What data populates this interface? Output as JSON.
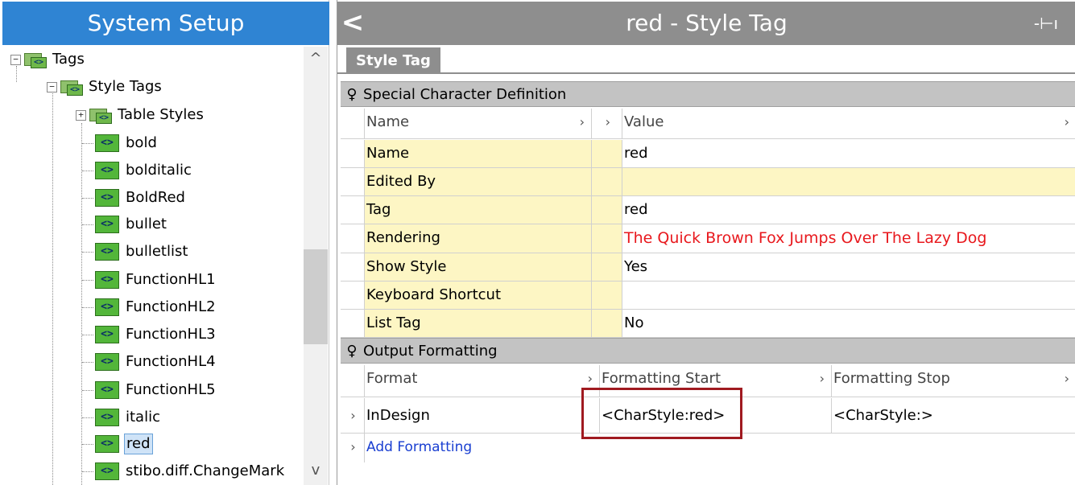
{
  "left_panel": {
    "title": "System Setup",
    "tree": [
      {
        "label": "Tags",
        "level": 0,
        "type": "folder",
        "expander": "−"
      },
      {
        "label": "Style Tags",
        "level": 1,
        "type": "folder",
        "expander": "−"
      },
      {
        "label": "Table Styles",
        "level": 2,
        "type": "folder",
        "expander": "+"
      },
      {
        "label": "bold",
        "level": 2,
        "type": "tag"
      },
      {
        "label": "bolditalic",
        "level": 2,
        "type": "tag"
      },
      {
        "label": "BoldRed",
        "level": 2,
        "type": "tag"
      },
      {
        "label": "bullet",
        "level": 2,
        "type": "tag"
      },
      {
        "label": "bulletlist",
        "level": 2,
        "type": "tag"
      },
      {
        "label": "FunctionHL1",
        "level": 2,
        "type": "tag"
      },
      {
        "label": "FunctionHL2",
        "level": 2,
        "type": "tag"
      },
      {
        "label": "FunctionHL3",
        "level": 2,
        "type": "tag"
      },
      {
        "label": "FunctionHL4",
        "level": 2,
        "type": "tag"
      },
      {
        "label": "FunctionHL5",
        "level": 2,
        "type": "tag"
      },
      {
        "label": "italic",
        "level": 2,
        "type": "tag"
      },
      {
        "label": "red",
        "level": 2,
        "type": "tag",
        "selected": true
      },
      {
        "label": "stibo.diff.ChangeMark",
        "level": 2,
        "type": "tag"
      }
    ],
    "tag_icon_text": "<>",
    "scroll_up": "^",
    "scroll_down": "v"
  },
  "right_panel": {
    "back_icon": "<",
    "title": "red - Style Tag",
    "pin_icon": "-⊢ı",
    "tab_label": "Style Tag",
    "special_section": {
      "title": "Special Character Definition",
      "header": {
        "name": "Name",
        "value": "Value"
      },
      "rows": [
        {
          "name": "Name",
          "value": "red"
        },
        {
          "name": "Edited By",
          "value": ""
        },
        {
          "name": "Tag",
          "value": "red"
        },
        {
          "name": "Rendering",
          "value": "The Quick Brown Fox Jumps Over The Lazy Dog"
        },
        {
          "name": "Show Style",
          "value": "Yes"
        },
        {
          "name": "Keyboard Shortcut",
          "value": ""
        },
        {
          "name": "List Tag",
          "value": "No"
        }
      ]
    },
    "output_section": {
      "title": "Output Formatting",
      "header": {
        "format": "Format",
        "start": "Formatting Start",
        "stop": "Formatting Stop"
      },
      "rows": [
        {
          "format": "InDesign",
          "start": "<CharStyle:red>",
          "stop": "<CharStyle:>"
        }
      ],
      "add_label": "Add Formatting"
    }
  },
  "colors": {
    "left_header": "#2f84d3",
    "right_header": "#8e8e8e",
    "rendering_text": "#e8181d",
    "highlight_border": "#a01a20",
    "add_link": "#1a3fd1",
    "yellow_cell": "#fdf6c4"
  }
}
